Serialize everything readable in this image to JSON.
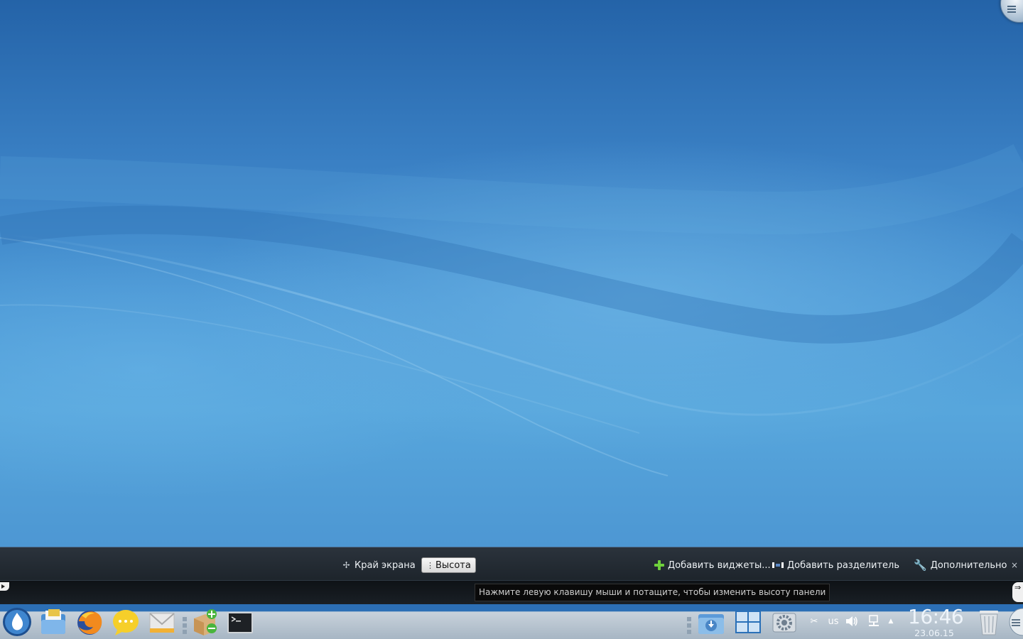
{
  "config_bar": {
    "screen_edge_label": "Край экрана",
    "height_label": "Высота",
    "add_widgets_label": "Добавить виджеты...",
    "add_spacer_label": "Добавить разделитель",
    "more_settings_label": "Дополнительно",
    "close_glyph": "×"
  },
  "ruler": {
    "tooltip": "Нажмите левую клавишу мыши и потащите, чтобы изменить высоту панели",
    "right_handle_glyph": "⇒"
  },
  "panel": {
    "launchers": [
      {
        "name": "app-menu-icon"
      },
      {
        "name": "file-manager-icon"
      },
      {
        "name": "firefox-icon"
      },
      {
        "name": "chat-icon"
      },
      {
        "name": "mail-icon"
      },
      {
        "name": "package-manager-icon"
      },
      {
        "name": "terminal-icon"
      }
    ],
    "tray": {
      "keyboard_layout": "us",
      "scissors_glyph": "✂",
      "volume_glyph": "🔊",
      "expand_glyph": "▲"
    },
    "clock": {
      "time": "16:46",
      "date": "23.06.15"
    }
  },
  "colors": {
    "wallpaper_top": "#2463a8",
    "wallpaper_mid": "#57a6dc",
    "config_bar": "#232b33",
    "panel_accent": "#2c6fb5"
  }
}
